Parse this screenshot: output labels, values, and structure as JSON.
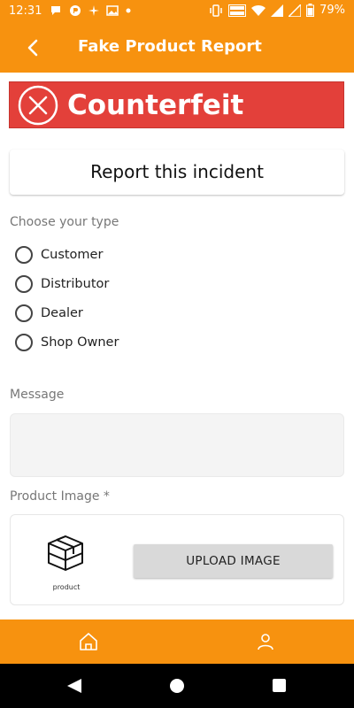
{
  "status_bar": {
    "time": "12:31",
    "battery": "79%"
  },
  "app_bar": {
    "title": "Fake Product Report"
  },
  "banner": {
    "text": "Counterfeit"
  },
  "report": {
    "title": "Report this incident"
  },
  "type_section": {
    "label": "Choose your type",
    "options": [
      "Customer",
      "Distributor",
      "Dealer",
      "Shop Owner"
    ]
  },
  "message": {
    "label": "Message",
    "value": ""
  },
  "product_image": {
    "label": "Product Image *",
    "thumb_label": "product",
    "upload_button": "UPLOAD IMAGE"
  },
  "colors": {
    "accent": "#F7920F",
    "banner": "#E3403A"
  }
}
